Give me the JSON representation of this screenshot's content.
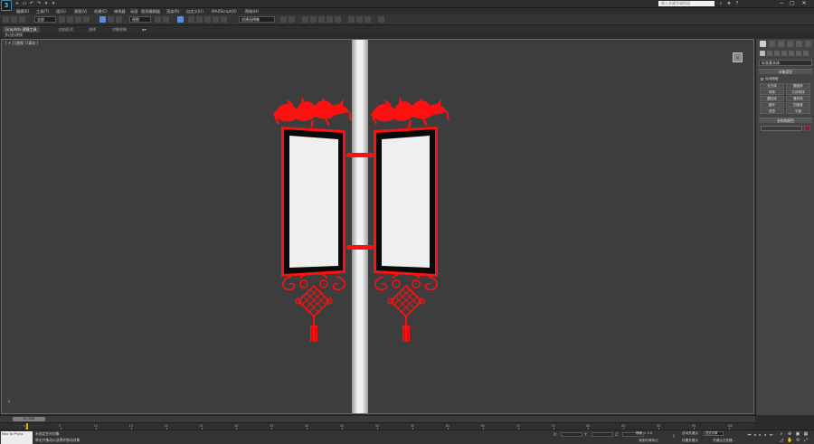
{
  "titlebar": {
    "logo_text": "3",
    "quick_access": [
      "+",
      "▭",
      "↶",
      "↷",
      "▾",
      "▾"
    ],
    "search_placeholder": "键入关键字或短语",
    "window_buttons": [
      "−",
      "▢",
      "✕"
    ]
  },
  "menubar": {
    "items": [
      "编辑(E)",
      "工具(T)",
      "组(G)",
      "视图(V)",
      "创建(C)",
      "修改器",
      "动画",
      "图形编辑器",
      "渲染(R)",
      "自定义(U)",
      "MAXScript(X)",
      "帮助(H)"
    ]
  },
  "toolbar": {
    "filter_value": "全部",
    "view_value": "视图",
    "selection_set_value": "创建选择集"
  },
  "ribbon": {
    "tabs": [
      "Graphite 建模工具",
      "自由形式",
      "选择",
      "对象绘制"
    ],
    "sub_label": "多边形建模"
  },
  "viewport": {
    "label": "[ + ] [透视 ] [真实 ]",
    "viewcube_label": "前"
  },
  "command_panel": {
    "category_value": "标准基本体",
    "object_type_label": "对象类型",
    "autogrid_label": "自动栅格",
    "buttons": [
      "长方体",
      "圆锥体",
      "球体",
      "几何球体",
      "圆柱体",
      "管状体",
      "圆环",
      "四棱锥",
      "茶壶",
      "平面"
    ],
    "name_color_label": "名称和颜色"
  },
  "timeline": {
    "slider_label": "0 / 100",
    "ticks": [
      "0",
      "5",
      "10",
      "15",
      "20",
      "25",
      "30",
      "35",
      "40",
      "45",
      "50",
      "55",
      "60",
      "65",
      "70",
      "75",
      "80",
      "85",
      "90",
      "95",
      "100"
    ]
  },
  "statusbar": {
    "maxscript_label": "Max to Physc",
    "status_line_1": "未选定任何对象",
    "status_line_2": "单击并拖动以选择并移动对象",
    "x_label": "X:",
    "y_label": "Y:",
    "z_label": "Z:",
    "grid_label": "栅格 = 0.0",
    "auto_key_label": "自动关键点",
    "set_key_label": "设置关键点",
    "selected_label": "选定对象",
    "key_filter_label": "关键点过滤器...",
    "add_time_tag": "添加时间标记"
  },
  "colors": {
    "accent_red": "#ff1010",
    "frame_black": "#0a0a0a",
    "panel_inner": "#efefef",
    "pole": "#e6e6e6",
    "viewport_bg": "#3d3d3d"
  }
}
